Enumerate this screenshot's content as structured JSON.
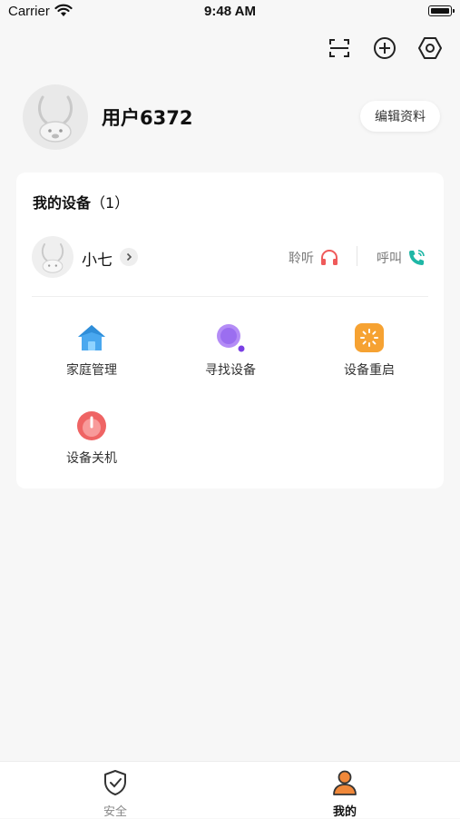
{
  "status_bar": {
    "carrier": "Carrier",
    "time": "9:48 AM"
  },
  "top_actions": {
    "icons": [
      "scan-icon",
      "add-circle-icon",
      "settings-hexagon-icon"
    ]
  },
  "profile": {
    "username": "用户6372",
    "edit_label": "编辑资料"
  },
  "devices": {
    "title": "我的设备",
    "count": "（1）",
    "device": {
      "name": "小七",
      "listen_label": "聆听",
      "call_label": "呼叫"
    },
    "actions": [
      {
        "label": "家庭管理",
        "icon": "house-icon",
        "color": "#4aa8ef"
      },
      {
        "label": "寻找设备",
        "icon": "magnifier-icon",
        "color": "#9b6ef0"
      },
      {
        "label": "设备重启",
        "icon": "restart-icon",
        "color": "#f6a232"
      },
      {
        "label": "设备关机",
        "icon": "power-icon",
        "color": "#ef6464"
      }
    ]
  },
  "tabbar": {
    "tabs": [
      {
        "label": "安全",
        "icon": "shield-check-icon",
        "active": false
      },
      {
        "label": "我的",
        "icon": "person-icon",
        "active": true
      }
    ],
    "active_color": "#f0883a"
  }
}
